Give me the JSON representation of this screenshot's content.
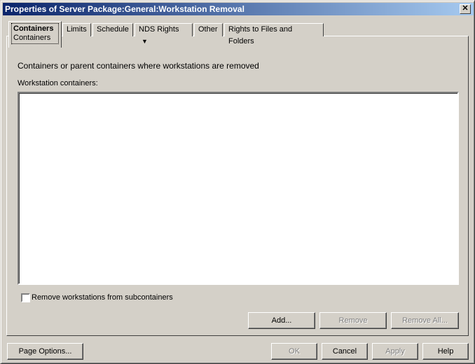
{
  "window": {
    "title": "Properties of Server Package:General:Workstation Removal",
    "close_icon": "close-icon"
  },
  "tabs": [
    {
      "label": "Containers",
      "sublabel": "Containers",
      "active": true
    },
    {
      "label": "Limits"
    },
    {
      "label": "Schedule"
    },
    {
      "label": "NDS Rights"
    },
    {
      "label": "Other"
    },
    {
      "label": "Rights to Files and Folders"
    }
  ],
  "panel": {
    "description": "Containers or parent containers where workstations are removed",
    "list_label": "Workstation containers:",
    "list_items": [],
    "checkbox_label": "Remove workstations from subcontainers",
    "checkbox_checked": false,
    "add": "Add...",
    "remove": "Remove",
    "remove_all": "Remove All..."
  },
  "footer": {
    "page_options": "Page Options...",
    "ok": "OK",
    "cancel": "Cancel",
    "apply": "Apply",
    "help": "Help"
  }
}
